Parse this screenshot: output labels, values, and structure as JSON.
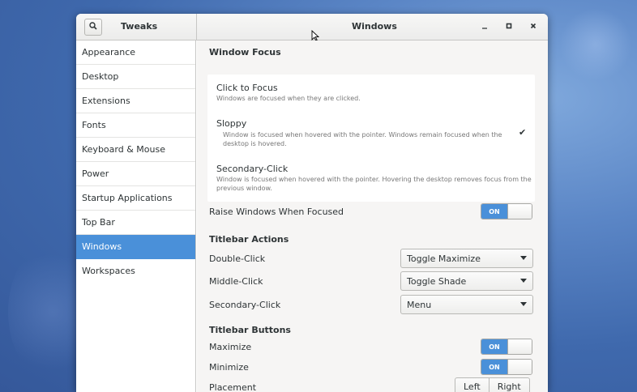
{
  "app": {
    "title": "Tweaks"
  },
  "panel": {
    "title": "Windows"
  },
  "sidebar": {
    "items": [
      {
        "label": "Appearance"
      },
      {
        "label": "Desktop"
      },
      {
        "label": "Extensions"
      },
      {
        "label": "Fonts"
      },
      {
        "label": "Keyboard & Mouse"
      },
      {
        "label": "Power"
      },
      {
        "label": "Startup Applications"
      },
      {
        "label": "Top Bar"
      },
      {
        "label": "Windows",
        "selected": true
      },
      {
        "label": "Workspaces"
      }
    ]
  },
  "window_focus": {
    "title": "Window Focus",
    "options": [
      {
        "title": "Click to Focus",
        "desc": "Windows are focused when they are clicked."
      },
      {
        "title": "Sloppy",
        "desc_line1": "Window is focused when hovered with the pointer. Windows remain focused when the",
        "desc_line2": "desktop is hovered.",
        "selected": true
      },
      {
        "title": "Secondary-Click",
        "desc_line1": "Window is focused when hovered with the pointer. Hovering the desktop removes focus from the",
        "desc_line2": "previous window."
      }
    ]
  },
  "raise": {
    "label": "Raise Windows When Focused",
    "state": "ON"
  },
  "titlebar_actions": {
    "title": "Titlebar Actions",
    "rows": [
      {
        "label": "Double-Click",
        "value": "Toggle Maximize"
      },
      {
        "label": "Middle-Click",
        "value": "Toggle Shade"
      },
      {
        "label": "Secondary-Click",
        "value": "Menu"
      }
    ]
  },
  "titlebar_buttons": {
    "title": "Titlebar Buttons",
    "maximize": {
      "label": "Maximize",
      "state": "ON"
    },
    "minimize": {
      "label": "Minimize",
      "state": "ON"
    },
    "placement": {
      "label": "Placement",
      "left": "Left",
      "right": "Right"
    }
  },
  "colors": {
    "accent": "#4a90d9",
    "desktop": "#4a74b8"
  },
  "icons": {
    "search": "search-icon",
    "minimize": "minimize-icon",
    "maximize": "maximize-icon",
    "close": "close-icon"
  }
}
